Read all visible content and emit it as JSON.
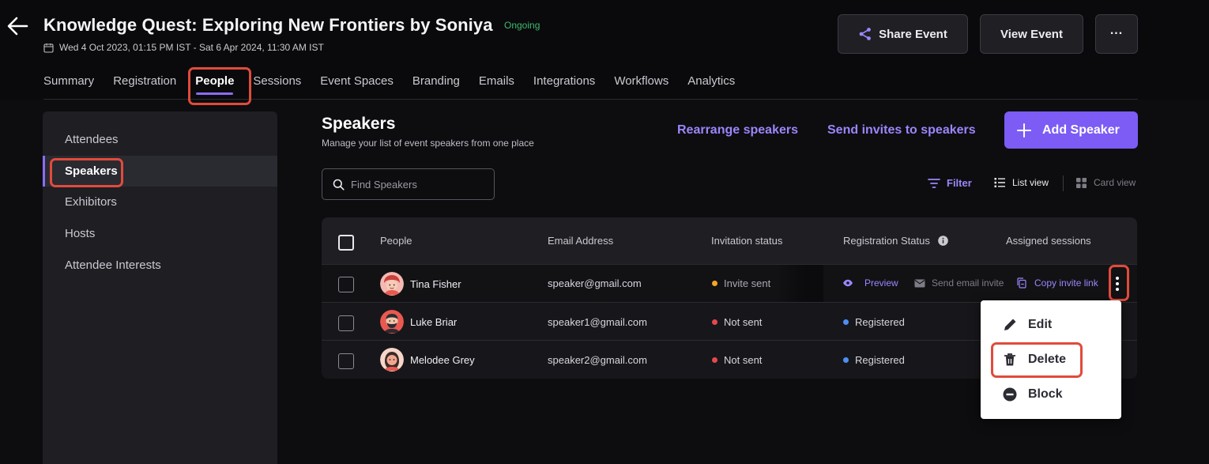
{
  "header": {
    "title": "Knowledge Quest: Exploring New Frontiers by Soniya",
    "status_badge": "Ongoing",
    "dates": "Wed 4 Oct 2023, 01:15 PM IST - Sat 6 Apr 2024, 11:30 AM IST",
    "share_label": "Share Event",
    "view_label": "View Event",
    "more_label": "..."
  },
  "tabs": [
    "Summary",
    "Registration",
    "People",
    "Sessions",
    "Event Spaces",
    "Branding",
    "Emails",
    "Integrations",
    "Workflows",
    "Analytics"
  ],
  "sidebar": {
    "items": [
      {
        "label": "Attendees"
      },
      {
        "label": "Speakers"
      },
      {
        "label": "Exhibitors"
      },
      {
        "label": "Hosts"
      },
      {
        "label": "Attendee Interests"
      }
    ]
  },
  "speakers": {
    "title": "Speakers",
    "subtitle": "Manage your list of event speakers from one place",
    "rearrange_label": "Rearrange speakers",
    "send_invites_label": "Send invites to speakers",
    "add_label": "Add Speaker",
    "search_placeholder": "Find Speakers",
    "filter_label": "Filter",
    "list_view_label": "List view",
    "card_view_label": "Card view"
  },
  "table": {
    "columns": [
      "People",
      "Email Address",
      "Invitation status",
      "Registration Status",
      "Assigned sessions"
    ],
    "rows": [
      {
        "name": "Tina Fisher",
        "email": "speaker@gmail.com",
        "invitation": "Invite sent",
        "registration": ""
      },
      {
        "name": "Luke Briar",
        "email": "speaker1@gmail.com",
        "invitation": "Not sent",
        "registration": "Registered"
      },
      {
        "name": "Melodee Grey",
        "email": "speaker2@gmail.com",
        "invitation": "Not sent",
        "registration": "Registered"
      }
    ],
    "row_actions": {
      "preview": "Preview",
      "send_email": "Send email invite",
      "copy_link": "Copy invite link"
    }
  },
  "context_menu": {
    "edit": "Edit",
    "delete": "Delete",
    "block": "Block"
  },
  "colors": {
    "accent": "#8b6cf6",
    "highlight": "#e14b3b",
    "ongoing": "#3dbb6e",
    "invite_sent": "#f5a623",
    "not_sent": "#e5484d",
    "registered": "#4f8ef7"
  }
}
